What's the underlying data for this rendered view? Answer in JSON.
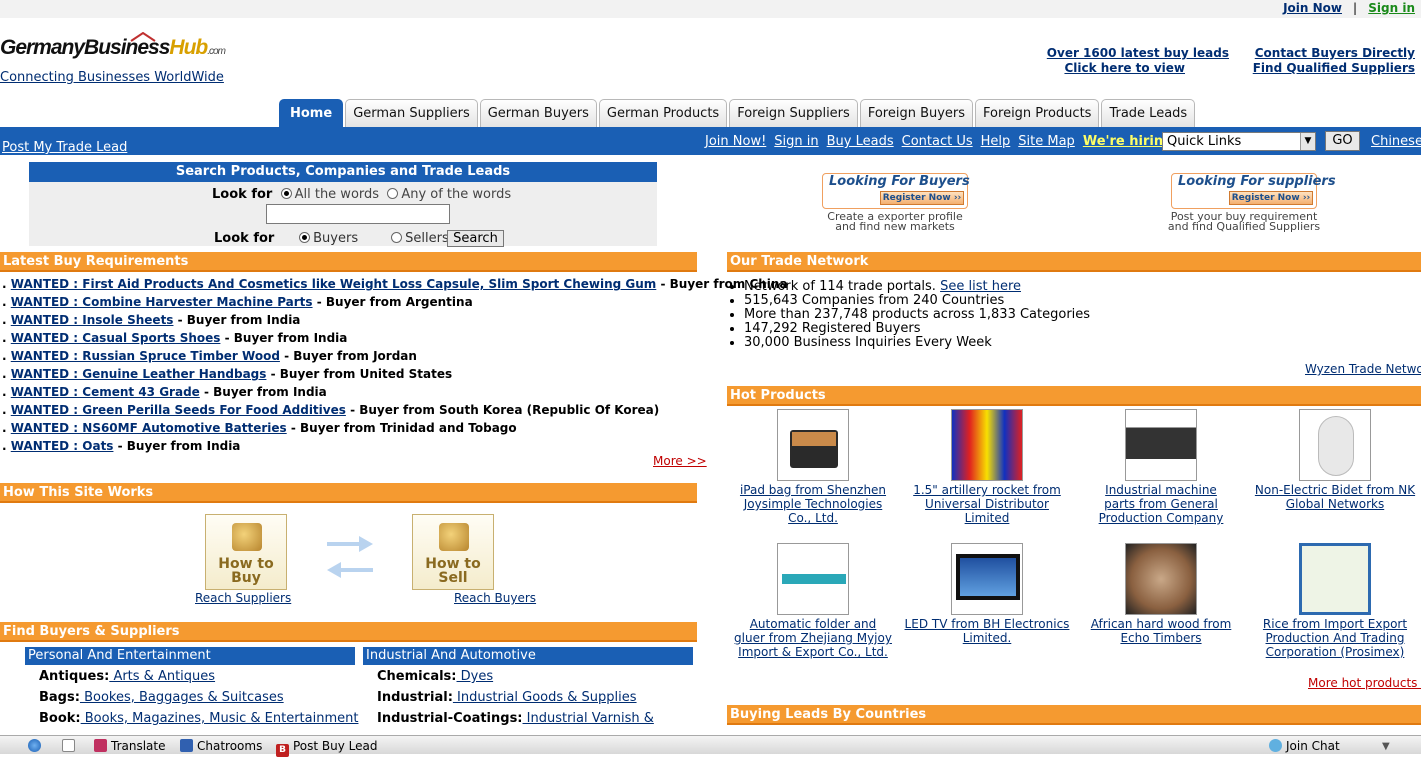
{
  "top": {
    "join_now": "Join Now",
    "sep": "|",
    "sign_in": "Sign in"
  },
  "logo": {
    "main": "GermanyBusiness",
    "hub": "Hub",
    "com": ".com",
    "tagline": "Connecting Businesses WorldWide"
  },
  "header_links": {
    "buy_leads_line1": "Over 1600 latest buy leads",
    "buy_leads_line2": "Click here to view",
    "contact_line1": "Contact Buyers Directly",
    "contact_line2": "Find Qualified Suppliers"
  },
  "tabs": [
    "Home",
    "German Suppliers",
    "German Buyers",
    "German Products",
    "Foreign Suppliers",
    "Foreign Buyers",
    "Foreign Products",
    "Trade Leads"
  ],
  "nav": {
    "post_trade": "Post My Trade Lead",
    "links": [
      "Join Now!",
      "Sign in",
      "Buy Leads",
      "Contact Us",
      "Help",
      "Site Map"
    ],
    "hiring": "We're hiring",
    "quick_links": "Quick Links",
    "go": "GO",
    "chinese": "Chinese"
  },
  "search": {
    "title": "Search Products, Companies and Trade Leads",
    "look_for": "Look for",
    "all_words": "All the words",
    "any_words": "Any of the words",
    "buyers": "Buyers",
    "sellers": "Sellers",
    "button": "Search"
  },
  "promos": {
    "buyers_title": "Looking For Buyers",
    "suppliers_title": "Looking For suppliers",
    "register": "Register Now",
    "buyers_text1": "Create a exporter profile",
    "buyers_text2": "and find new markets",
    "suppliers_text1": "Post your buy requirement",
    "suppliers_text2": "and find Qualified Suppliers"
  },
  "latest_buy": {
    "title": "Latest Buy Requirements",
    "items": [
      {
        "w": "WANTED : First Aid Products And Cosmetics like Weight Loss Capsule, Slim Sport Chewing Gum",
        "from": " - Buyer from China"
      },
      {
        "w": "WANTED : Combine Harvester Machine Parts",
        "from": " - Buyer from Argentina"
      },
      {
        "w": "WANTED : Insole Sheets",
        "from": " - Buyer from India"
      },
      {
        "w": "WANTED : Casual Sports Shoes",
        "from": " - Buyer from India"
      },
      {
        "w": "WANTED : Russian Spruce Timber Wood",
        "from": " - Buyer from Jordan"
      },
      {
        "w": "WANTED : Genuine Leather Handbags",
        "from": " - Buyer from United States"
      },
      {
        "w": "WANTED : Cement 43 Grade",
        "from": " - Buyer from India"
      },
      {
        "w": "WANTED : Green Perilla Seeds For Food Additives",
        "from": " - Buyer from South Korea (Republic Of Korea)"
      },
      {
        "w": "WANTED : NS60MF Automotive Batteries",
        "from": " - Buyer from Trinidad and Tobago"
      },
      {
        "w": "WANTED : Oats",
        "from": " - Buyer from India"
      }
    ],
    "more": "More >>"
  },
  "network": {
    "title": "Our Trade Network",
    "line1": "Network of 114 trade portals.",
    "line1_link": "See list here",
    "line2": "515,643 Companies from 240 Countries",
    "line3": "More than 237,748 products across 1,833 Categories",
    "line4": "147,292 Registered Buyers",
    "line5": "30,000 Business Inquiries Every Week",
    "wyzen": "Wyzen Trade Network"
  },
  "how": {
    "title": "How This Site Works",
    "buy": "How to Buy",
    "sell": "How to Sell",
    "reach_suppliers": "Reach Suppliers",
    "reach_buyers": "Reach Buyers"
  },
  "hot": {
    "title": "Hot Products",
    "items": [
      [
        "iPad bag from Shenzhen",
        "Joysimple Technologies",
        "Co., Ltd."
      ],
      [
        "1.5\" artillery rocket from",
        "Universal Distributor",
        "Limited"
      ],
      [
        "Industrial machine",
        "parts from General",
        "Production Company"
      ],
      [
        "Non-Electric Bidet from NK",
        "Global Networks",
        ""
      ],
      [
        "Automatic folder and",
        "gluer from Zhejiang Myjoy",
        "Import & Export Co., Ltd."
      ],
      [
        "LED TV from BH Electronics",
        "Limited.",
        ""
      ],
      [
        "African hard wood from",
        "Echo Timbers",
        ""
      ],
      [
        "Rice from Import Export",
        "Production And Trading",
        "Corporation (Prosimex)"
      ]
    ],
    "more": "More hot products >>"
  },
  "find": {
    "title": "Find Buyers & Suppliers",
    "cat1": "Personal And Entertainment",
    "cat2": "Industrial And Automotive",
    "left": [
      {
        "k": "Antiques:",
        "v": " Arts & Antiques"
      },
      {
        "k": "Bags:",
        "v": " Bookes, Baggages & Suitcases"
      },
      {
        "k": "Book:",
        "v": " Books, Magazines, Music & Entertainment"
      }
    ],
    "right": [
      {
        "k": "Chemicals:",
        "v": " Dyes"
      },
      {
        "k": "Industrial:",
        "v": " Industrial Goods & Supplies"
      },
      {
        "k": "Industrial-Coatings:",
        "v": " Industrial Varnish &"
      }
    ]
  },
  "countries": {
    "title": "Buying Leads By Countries"
  },
  "taskbar": {
    "translate": "Translate",
    "chatrooms": "Chatrooms",
    "post_buy": "Post Buy Lead",
    "join_chat": "Join Chat"
  }
}
